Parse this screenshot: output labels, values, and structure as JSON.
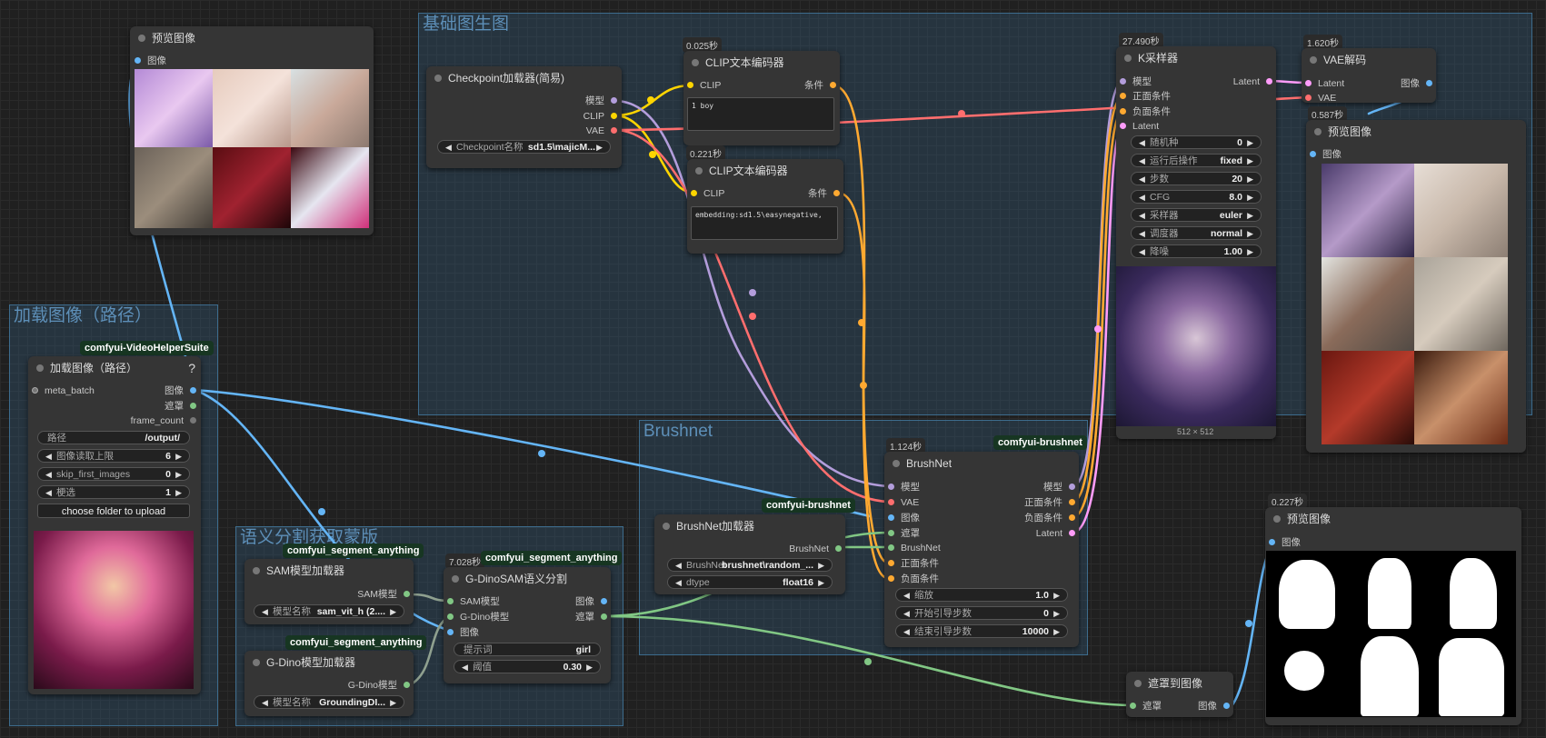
{
  "colors": {
    "clip": "#ffd500",
    "vae": "#ff6e6e",
    "model": "#b39ddb",
    "image": "#64b5f6",
    "mask": "#81c784",
    "cond": "#ffa931",
    "latent": "#ff9cf9",
    "gdino": "#81c784"
  },
  "groups": {
    "txt2img": "基础图生图",
    "load_image": "加载图像（路径）",
    "brushnet": "Brushnet",
    "segment": "语义分割获取蒙版"
  },
  "nodes": {
    "preview1": {
      "title": "预览图像",
      "in_image": "图像"
    },
    "checkpoint": {
      "title": "Checkpoint加载器(简易)",
      "out_model": "模型",
      "out_clip": "CLIP",
      "out_vae": "VAE",
      "w_name": "Checkpoint名称",
      "w_value": "sd1.5\\majicM..."
    },
    "clip1": {
      "badge": "0.025秒",
      "title": "CLIP文本编码器",
      "in_clip": "CLIP",
      "out_cond": "条件",
      "text": "1 boy"
    },
    "clip2": {
      "badge": "0.221秒",
      "title": "CLIP文本编码器",
      "in_clip": "CLIP",
      "out_cond": "条件",
      "text": "embedding:sd1.5\\easynegative,"
    },
    "ksampler": {
      "badge": "27.490秒",
      "title": "K采样器",
      "in_model": "模型",
      "in_pos": "正面条件",
      "in_neg": "负面条件",
      "in_latent": "Latent",
      "out_latent": "Latent",
      "widgets": [
        {
          "name": "随机种",
          "value": "0"
        },
        {
          "name": "运行后操作",
          "value": "fixed"
        },
        {
          "name": "步数",
          "value": "20"
        },
        {
          "name": "CFG",
          "value": "8.0"
        },
        {
          "name": "采样器",
          "value": "euler"
        },
        {
          "name": "调度器",
          "value": "normal"
        },
        {
          "name": "降噪",
          "value": "1.00"
        }
      ],
      "image_size": "512 × 512"
    },
    "vaedecode": {
      "badge": "1.620秒",
      "title": "VAE解码",
      "in_latent": "Latent",
      "in_vae": "VAE",
      "out_image": "图像"
    },
    "preview2": {
      "badge": "0.587秒",
      "title": "预览图像",
      "in_image": "图像"
    },
    "loadimage": {
      "pkg": "comfyui-VideoHelperSuite",
      "title": "加载图像（路径）",
      "help": "?",
      "in_meta": "meta_batch",
      "out_image": "图像",
      "out_mask": "遮罩",
      "out_frames": "frame_count",
      "widgets": [
        {
          "name": "路径",
          "value": "/output/"
        },
        {
          "name": "图像读取上限",
          "value": "6"
        },
        {
          "name": "skip_first_images",
          "value": "0"
        },
        {
          "name": "梗选",
          "value": "1"
        }
      ],
      "button": "choose folder to upload"
    },
    "brushnet": {
      "badge": "1.124秒",
      "pkg": "comfyui-brushnet",
      "title": "BrushNet",
      "in_model": "模型",
      "in_vae": "VAE",
      "in_image": "图像",
      "in_mask": "遮罩",
      "in_brushnet": "BrushNet",
      "in_pos": "正面条件",
      "in_neg": "负面条件",
      "out_model": "模型",
      "out_pos": "正面条件",
      "out_neg": "负面条件",
      "out_latent": "Latent",
      "widgets": [
        {
          "name": "缩放",
          "value": "1.0"
        },
        {
          "name": "开始引导步数",
          "value": "0"
        },
        {
          "name": "结束引导步数",
          "value": "10000"
        }
      ]
    },
    "brushnetloader": {
      "pkg": "comfyui-brushnet",
      "title": "BrushNet加载器",
      "out": "BrushNet",
      "widgets": [
        {
          "name": "BrushNet",
          "value": "brushnet\\random_..."
        },
        {
          "name": "dtype",
          "value": "float16"
        }
      ]
    },
    "samloader": {
      "pkg": "comfyui_segment_anything",
      "title": "SAM模型加载器",
      "out": "SAM模型",
      "w_name": "模型名称",
      "w_value": "sam_vit_h (2...."
    },
    "gdinoloader": {
      "pkg": "comfyui_segment_anything",
      "title": "G-Dino模型加载器",
      "out": "G-Dino模型",
      "w_name": "模型名称",
      "w_value": "GroundingDI..."
    },
    "gdinosam": {
      "badge": "7.028秒",
      "pkg": "comfyui_segment_anything",
      "title": "G-DinoSAM语义分割",
      "in_sam": "SAM模型",
      "in_gdino": "G-Dino模型",
      "in_image": "图像",
      "out_image": "图像",
      "out_mask": "遮罩",
      "prompt_name": "提示词",
      "prompt_value": "girl",
      "thresh_name": "阈值",
      "thresh_value": "0.30"
    },
    "mask2img": {
      "title": "遮罩到图像",
      "in_mask": "遮罩",
      "out_image": "图像"
    },
    "preview3": {
      "badge": "0.227秒",
      "title": "预览图像",
      "in_image": "图像"
    }
  }
}
